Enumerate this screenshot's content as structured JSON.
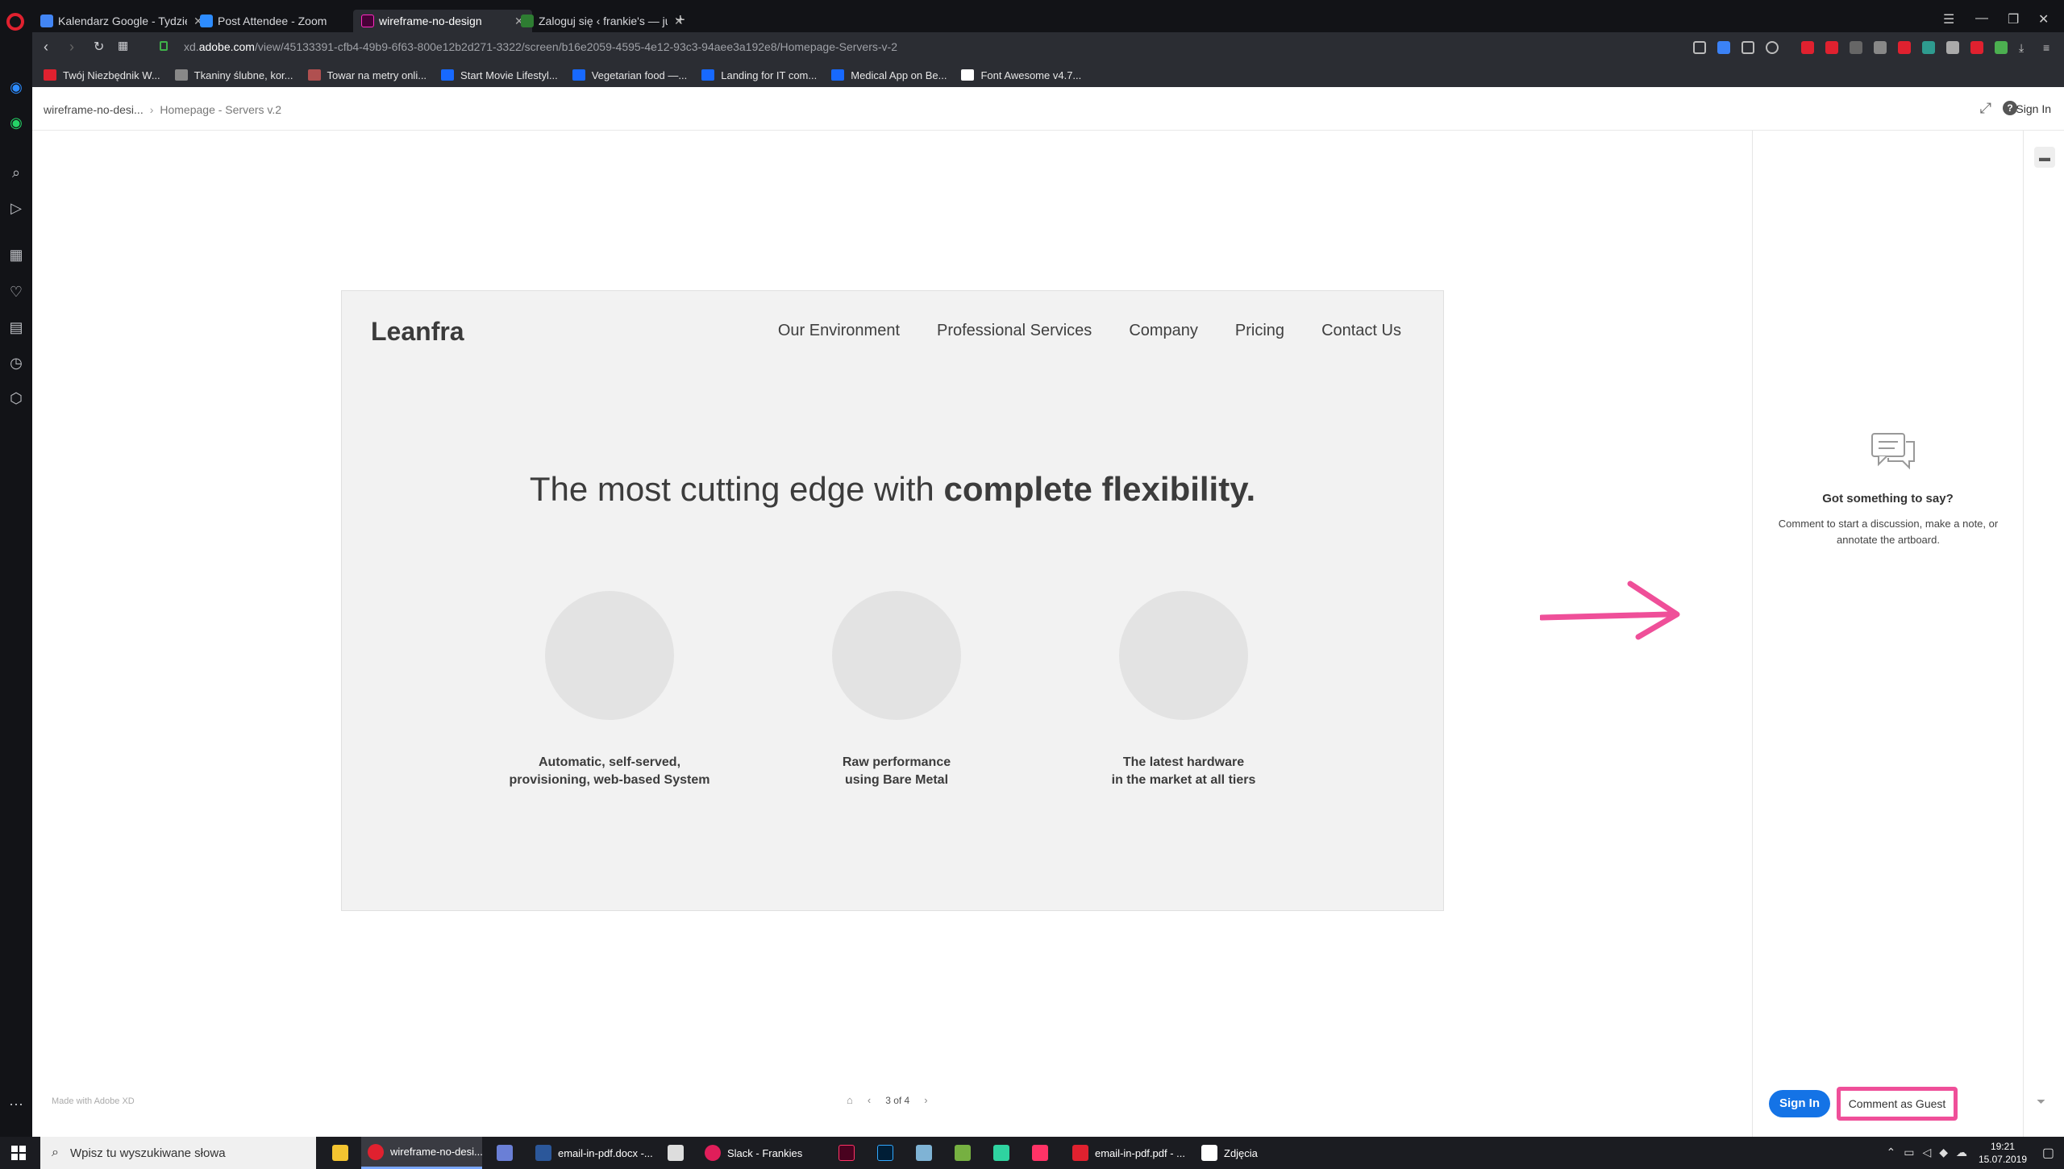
{
  "browser": {
    "tabs": [
      {
        "label": "Kalendarz Google - Tydzień",
        "icon_color": "#4285f4",
        "active": false
      },
      {
        "label": "Post Attendee - Zoom",
        "icon_color": "#2d8cff",
        "active": false
      },
      {
        "label": "wireframe-no-design",
        "icon_color": "#ff2bc2",
        "active": true
      },
      {
        "label": "Zaloguj się ‹ frankie's — ju",
        "icon_color": "#2e7d32",
        "active": false
      }
    ],
    "url_prefix": "xd.",
    "url_domain": "adobe.com",
    "url_path": "/view/45133391-cfb4-49b9-6f63-800e12b2d271-3322/screen/b16e2059-4595-4e12-93c3-94aee3a192e8/Homepage-Servers-v-2",
    "bookmarks": [
      {
        "label": "Twój Niezbędnik W...",
        "icon_color": "#e0212f"
      },
      {
        "label": "Tkaniny ślubne, kor...",
        "icon_color": "#888888"
      },
      {
        "label": "Towar na metry onli...",
        "icon_color": "#b05050"
      },
      {
        "label": "Start Movie Lifestyl...",
        "icon_color": "#1769ff"
      },
      {
        "label": "Vegetarian food —...",
        "icon_color": "#1769ff"
      },
      {
        "label": "Landing for IT com...",
        "icon_color": "#1769ff"
      },
      {
        "label": "Medical App on Be...",
        "icon_color": "#1769ff"
      },
      {
        "label": "Font Awesome v4.7...",
        "icon_color": "#ffffff"
      }
    ]
  },
  "xd": {
    "breadcrumb_root": "wireframe-no-desi...",
    "breadcrumb_current": "Homepage - Servers v.2",
    "header_signin": "Sign In",
    "help_label": "?",
    "made_with": "Made with Adobe XD",
    "pager": "3 of 4"
  },
  "artboard": {
    "logo": "Leanfra",
    "menu": [
      "Our Environment",
      "Professional Services",
      "Company",
      "Pricing",
      "Contact Us"
    ],
    "hero_light": "The most cutting edge with ",
    "hero_bold": "complete flexibility.",
    "features": [
      {
        "line1": "Automatic, self-served,",
        "line2": "provisioning, web-based System"
      },
      {
        "line1": "Raw performance",
        "line2": "using Bare Metal"
      },
      {
        "line1": "The latest hardware",
        "line2": "in the market at all tiers"
      }
    ]
  },
  "comments": {
    "title": "Got something to say?",
    "description": "Comment to start a discussion, make a note, or annotate the artboard.",
    "signin_button": "Sign In",
    "guest_button": "Comment as Guest",
    "highlight_color": "#ef4f99"
  },
  "taskbar": {
    "search_placeholder": "Wpisz tu wyszukiwane słowa",
    "items": [
      {
        "label": "",
        "icon_color": "#f4c430"
      },
      {
        "label": "wireframe-no-desi...",
        "icon_color": "#e0212f",
        "active": true
      },
      {
        "label": "",
        "icon_color": "#6a7fd6"
      },
      {
        "label": "email-in-pdf.docx -...",
        "icon_color": "#2b579a"
      },
      {
        "label": "",
        "icon_color": "#dddddd"
      },
      {
        "label": "Slack - Frankies",
        "icon_color": "#e01e5a"
      },
      {
        "label": "",
        "icon_color": "#ff3366"
      },
      {
        "label": "",
        "icon_color": "#31a8ff"
      },
      {
        "label": "",
        "icon_color": "#7fb3d5"
      },
      {
        "label": "",
        "icon_color": "#76b041"
      },
      {
        "label": "",
        "icon_color": "#2fd3a0"
      },
      {
        "label": "",
        "icon_color": "#ff3366"
      },
      {
        "label": "email-in-pdf.pdf - ...",
        "icon_color": "#e0212f"
      },
      {
        "label": "Zdjęcia",
        "icon_color": "#ffffff"
      }
    ],
    "time": "19:21",
    "date": "15.07.2019"
  }
}
